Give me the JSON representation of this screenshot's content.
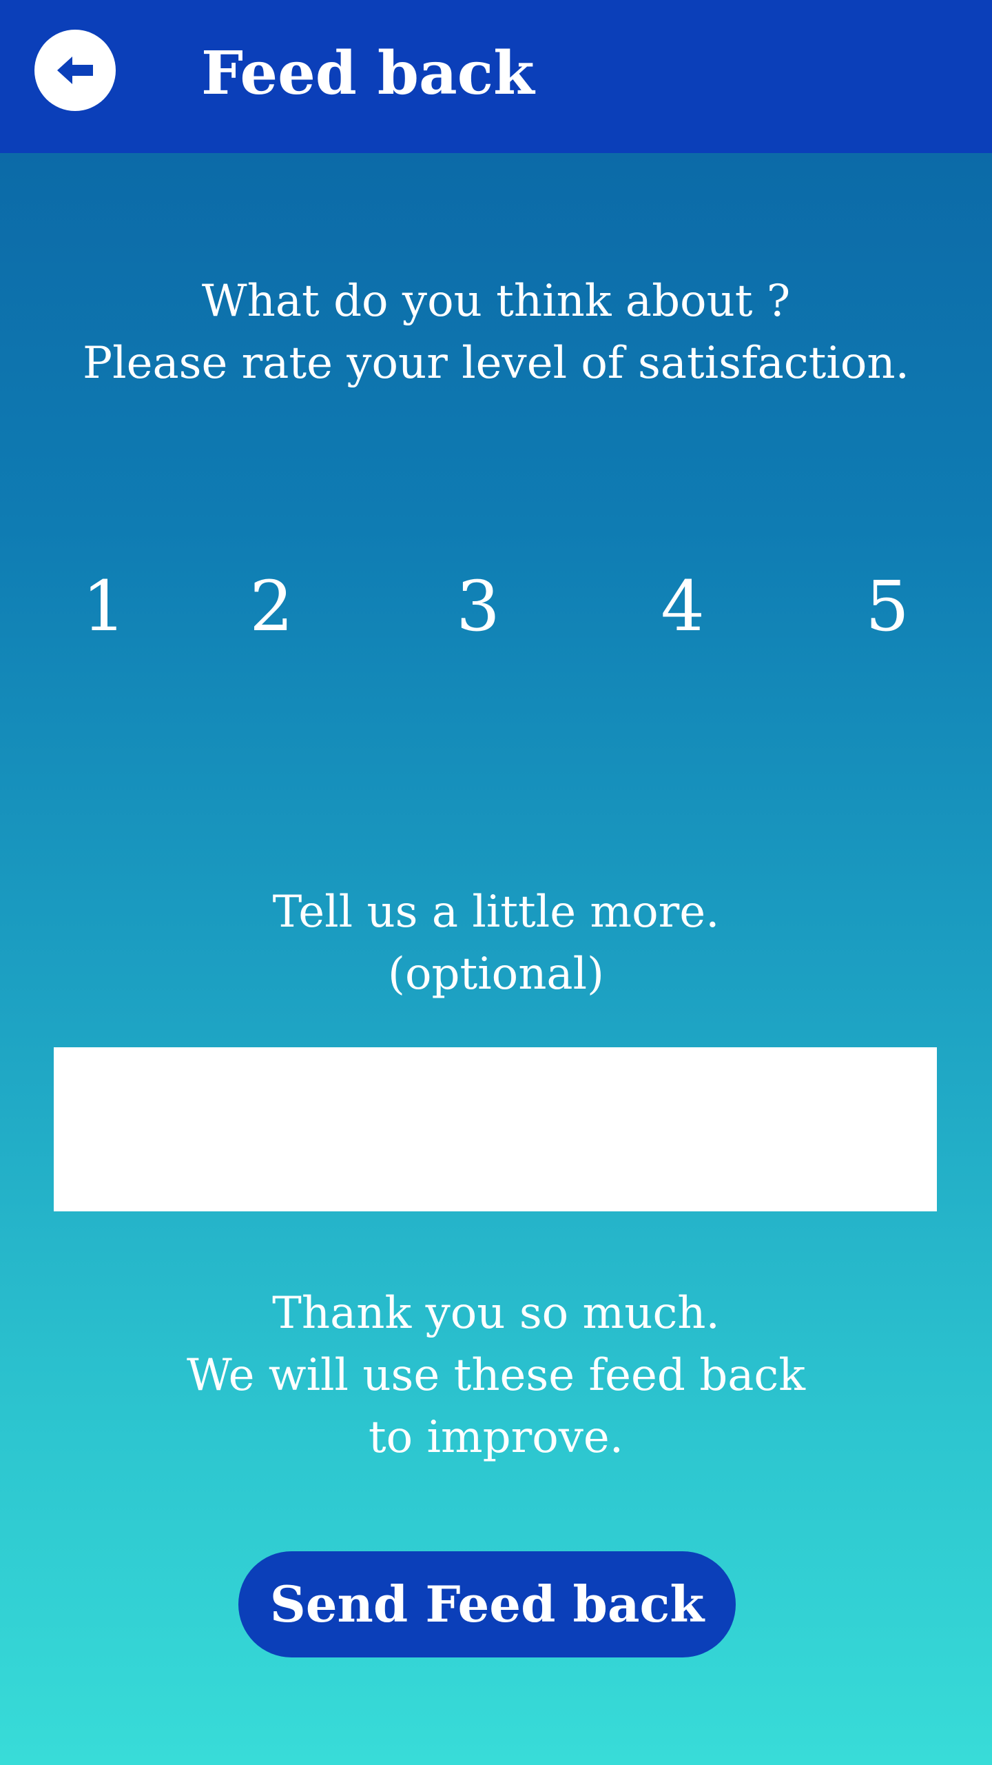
{
  "header": {
    "title": "Feed back",
    "back_icon": "arrow-left-icon"
  },
  "question": {
    "line1": "What do you think about ?",
    "line2": "Please rate your level of satisfaction."
  },
  "rating": {
    "options": [
      "1",
      "2",
      "3",
      "4",
      "5"
    ]
  },
  "more": {
    "line1": "Tell us a little more.",
    "line2": "(optional)"
  },
  "feedback_input": {
    "value": "",
    "placeholder": ""
  },
  "thanks": {
    "line1": "Thank you so much.",
    "line2": "We will use these feed back",
    "line3": "to improve."
  },
  "send_button": {
    "label": "Send Feed back"
  },
  "colors": {
    "header": "#0b3fb9",
    "gradient_top": "#0b63a3",
    "gradient_bottom": "#38dcd8",
    "button": "#0b3fb9",
    "text": "#ffffff"
  }
}
